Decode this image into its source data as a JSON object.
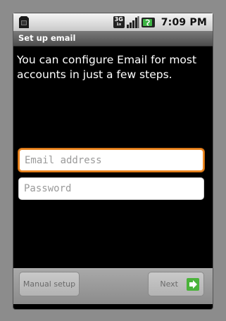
{
  "status_bar": {
    "network_type": "3G",
    "network_sub": "1x",
    "time": "7:09 PM"
  },
  "title_bar": {
    "title": "Set up email"
  },
  "main": {
    "intro": "You can configure Email for most accounts in just a few steps."
  },
  "form": {
    "email_placeholder": "Email address",
    "email_value": "",
    "password_placeholder": "Password",
    "password_value": ""
  },
  "buttons": {
    "manual_label": "Manual setup",
    "next_label": "Next"
  },
  "colors": {
    "focus_border": "#f08a24",
    "battery_green": "#3db544",
    "next_arrow_green": "#4ab33a"
  },
  "icons": [
    "sim-card-icon",
    "network-3g-icon",
    "signal-strength-icon",
    "battery-charging-icon",
    "next-arrow-icon"
  ]
}
